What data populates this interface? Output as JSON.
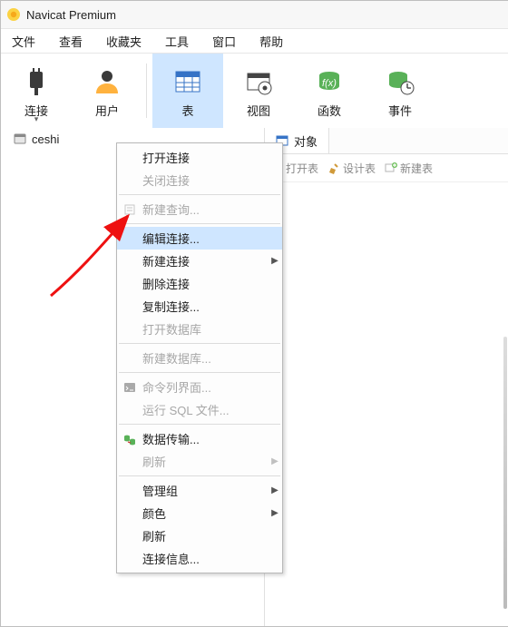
{
  "title": "Navicat Premium",
  "menubar": [
    "文件",
    "查看",
    "收藏夹",
    "工具",
    "窗口",
    "帮助"
  ],
  "toolbar": [
    {
      "id": "connection",
      "label": "连接",
      "icon": "plug",
      "dropdown": true
    },
    {
      "id": "user",
      "label": "用户",
      "icon": "user"
    },
    {
      "id": "sep"
    },
    {
      "id": "table",
      "label": "表",
      "icon": "table",
      "selected": true
    },
    {
      "id": "view",
      "label": "视图",
      "icon": "view"
    },
    {
      "id": "function",
      "label": "函数",
      "icon": "function"
    },
    {
      "id": "event",
      "label": "事件",
      "icon": "event"
    }
  ],
  "objects_tab": {
    "label": "对象"
  },
  "actions_row": [
    {
      "id": "open",
      "label": "打开表",
      "icon": "openTable"
    },
    {
      "id": "design",
      "label": "设计表",
      "icon": "designTable"
    },
    {
      "id": "new",
      "label": "新建表",
      "icon": "newTable"
    }
  ],
  "nav": {
    "items": [
      {
        "label": "ceshi"
      }
    ]
  },
  "context_menu": {
    "groups": [
      [
        {
          "label": "打开连接"
        },
        {
          "label": "关闭连接",
          "disabled": true
        }
      ],
      [
        {
          "label": "新建查询...",
          "disabled": true,
          "icon": "query"
        }
      ],
      [
        {
          "label": "编辑连接...",
          "hover": true
        },
        {
          "label": "新建连接",
          "submenu": true
        },
        {
          "label": "删除连接"
        },
        {
          "label": "复制连接..."
        },
        {
          "label": "打开数据库",
          "disabled": true
        }
      ],
      [
        {
          "label": "新建数据库...",
          "disabled": true
        }
      ],
      [
        {
          "label": "命令列界面...",
          "disabled": true,
          "icon": "cli"
        },
        {
          "label": "运行 SQL 文件...",
          "disabled": true
        }
      ],
      [
        {
          "label": "数据传输...",
          "icon": "transfer"
        },
        {
          "label": "刷新",
          "submenu": true,
          "disabled": true
        }
      ],
      [
        {
          "label": "管理组",
          "submenu": true
        },
        {
          "label": "颜色",
          "submenu": true
        },
        {
          "label": "刷新"
        },
        {
          "label": "连接信息..."
        }
      ]
    ]
  }
}
